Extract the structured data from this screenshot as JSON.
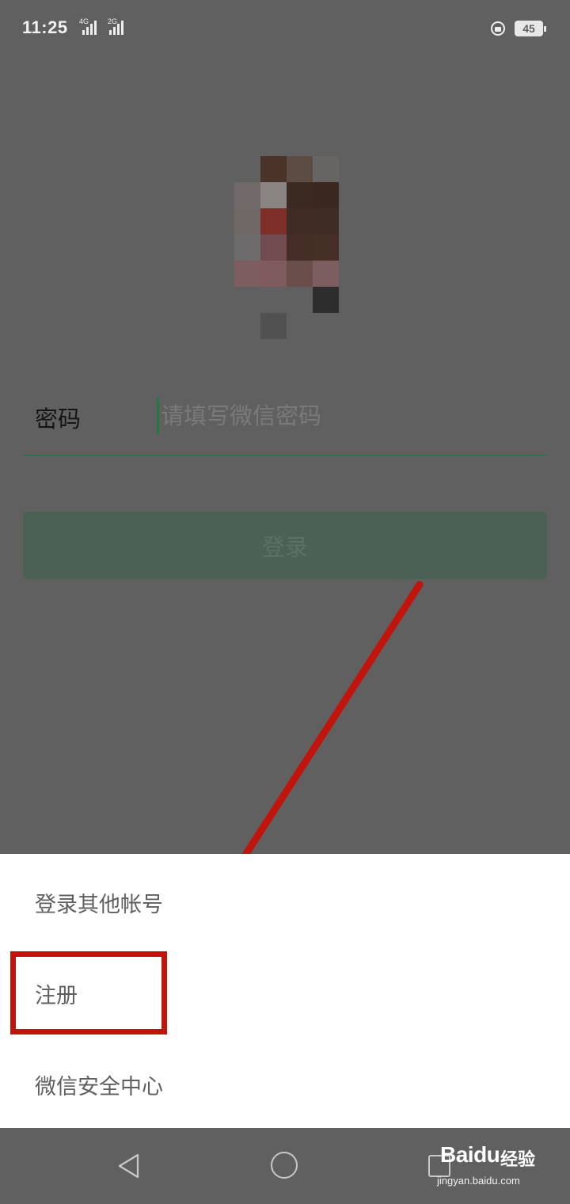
{
  "status_bar": {
    "time": "11:25",
    "network_1": "4G",
    "network_2": "2G",
    "battery": "45"
  },
  "login": {
    "password_label": "密码",
    "password_placeholder": "请填写微信密码",
    "login_button": "登录"
  },
  "bottom_sheet": {
    "items": [
      {
        "label": "登录其他帐号"
      },
      {
        "label": "注册"
      },
      {
        "label": "微信安全中心"
      }
    ]
  },
  "colors": {
    "annotation_red": "#c0140c",
    "accent_green": "#1f7a46"
  },
  "watermark": {
    "brand": "Baidu",
    "product": "经验",
    "url": "jingyan.baidu.com"
  }
}
